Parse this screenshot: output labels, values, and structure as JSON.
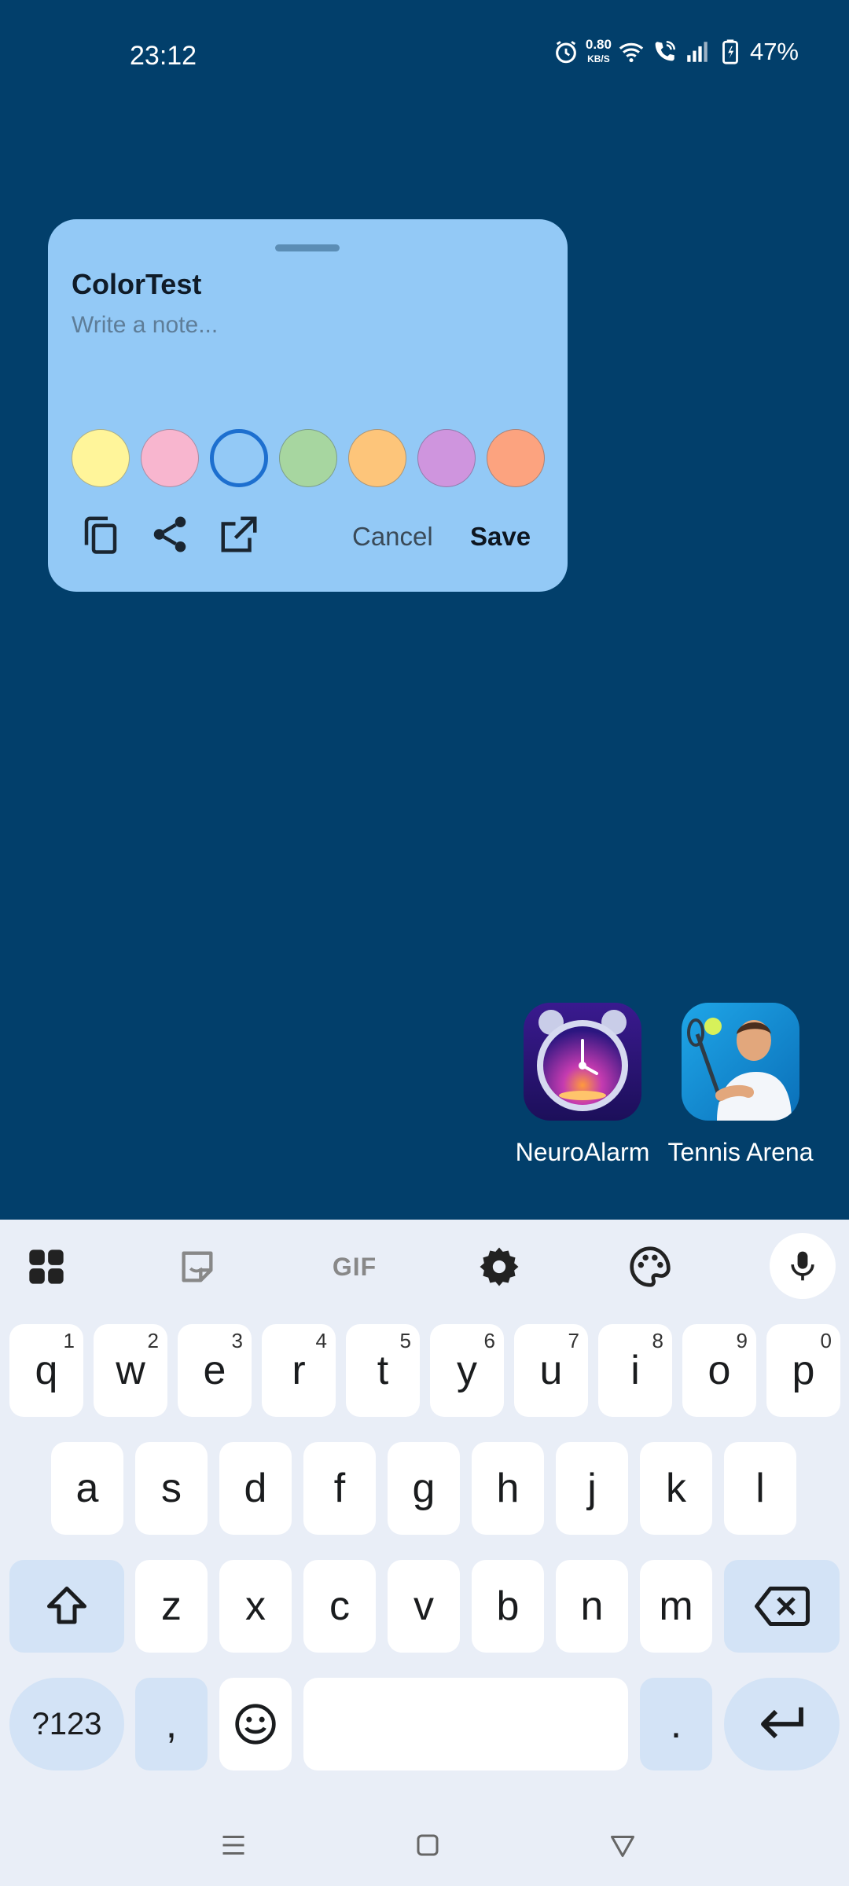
{
  "status_bar": {
    "time": "23:12",
    "net_speed": "0.80",
    "net_unit": "KB/S",
    "battery": "47%",
    "icons": [
      "alarm-icon",
      "wifi-icon",
      "wifi-calling-icon",
      "signal-icon",
      "battery-charging-icon"
    ]
  },
  "note": {
    "title": "ColorTest",
    "placeholder": "Write a note...",
    "swatches": [
      {
        "name": "yellow",
        "color": "#FFF59A"
      },
      {
        "name": "pink",
        "color": "#F8B6CF"
      },
      {
        "name": "blue",
        "color": "#93C9F6",
        "selected": true
      },
      {
        "name": "green",
        "color": "#A7D6A0"
      },
      {
        "name": "orange",
        "color": "#FDC57A"
      },
      {
        "name": "purple",
        "color": "#CF95DE"
      },
      {
        "name": "coral",
        "color": "#FCA37F"
      }
    ],
    "cancel_label": "Cancel",
    "save_label": "Save",
    "tools": [
      "copy-icon",
      "share-icon",
      "open-external-icon"
    ]
  },
  "apps": [
    {
      "label": "NeuroAlarm",
      "icon": "neuroalarm-app-icon"
    },
    {
      "label": "Tennis Arena",
      "icon": "tennis-arena-app-icon"
    }
  ],
  "keyboard": {
    "toolbar": [
      "apps-grid-icon",
      "sticker-icon",
      "gif-icon",
      "settings-icon",
      "palette-icon",
      "mic-icon"
    ],
    "gif_label": "GIF",
    "row1": [
      {
        "key": "q",
        "hint": "1"
      },
      {
        "key": "w",
        "hint": "2"
      },
      {
        "key": "e",
        "hint": "3"
      },
      {
        "key": "r",
        "hint": "4"
      },
      {
        "key": "t",
        "hint": "5"
      },
      {
        "key": "y",
        "hint": "6"
      },
      {
        "key": "u",
        "hint": "7"
      },
      {
        "key": "i",
        "hint": "8"
      },
      {
        "key": "o",
        "hint": "9"
      },
      {
        "key": "p",
        "hint": "0"
      }
    ],
    "row2": [
      "a",
      "s",
      "d",
      "f",
      "g",
      "h",
      "j",
      "k",
      "l"
    ],
    "row3": [
      "z",
      "x",
      "c",
      "v",
      "b",
      "n",
      "m"
    ],
    "symbols_label": "?123",
    "comma": ",",
    "period": ".",
    "colors": {
      "key": "#FFFFFF",
      "modifier": "#D3E3F6",
      "background": "#E9EEF7"
    }
  },
  "nav_bar": [
    "menu-icon",
    "home-icon",
    "back-icon"
  ],
  "colors": {
    "wallpaper": "#023F6B",
    "note_background": "#93C9F6",
    "selected_ring": "#1D6FCF"
  }
}
